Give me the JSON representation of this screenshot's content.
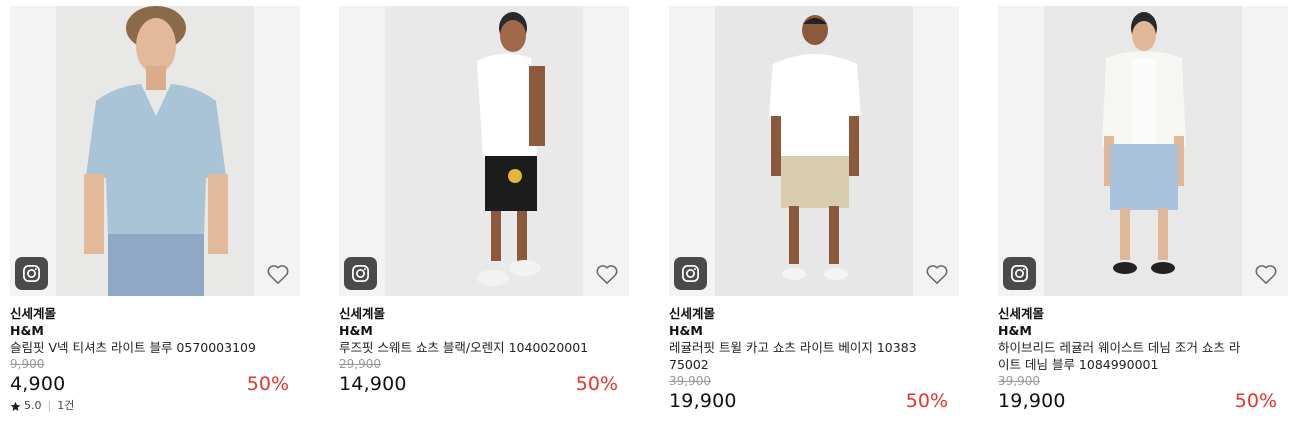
{
  "products": [
    {
      "shop": "신세계몰",
      "brand": "H&M",
      "name": "슬림핏 V넥 티셔츠 라이트 블루 0570003109",
      "original_price": "9,900",
      "price": "4,900",
      "discount": "50%",
      "rating_score": "5.0",
      "review_count": "1건",
      "icons": [
        "instagram-icon",
        "heart-icon",
        "star-icon"
      ]
    },
    {
      "shop": "신세계몰",
      "brand": "H&M",
      "name": "루즈핏 스웨트 쇼츠 블랙/오렌지 1040020001",
      "original_price": "29,900",
      "price": "14,900",
      "discount": "50%",
      "icons": [
        "instagram-icon",
        "heart-icon"
      ]
    },
    {
      "shop": "신세계몰",
      "brand": "H&M",
      "name": "레귤러핏 트윌 카고 쇼츠 라이트 베이지 1038375002",
      "original_price": "39,900",
      "price": "19,900",
      "discount": "50%",
      "icons": [
        "instagram-icon",
        "heart-icon"
      ]
    },
    {
      "shop": "신세계몰",
      "brand": "H&M",
      "name": "하이브리드 레귤러 웨이스트 데님 조거 쇼츠 라이트 데님 블루 1084990001",
      "original_price": "39,900",
      "price": "19,900",
      "discount": "50%",
      "icons": [
        "instagram-icon",
        "heart-icon"
      ]
    }
  ],
  "colors": {
    "discount": "#e4342b",
    "strikethrough": "#9a9a9a",
    "insta_button_bg": "#4a4a4a"
  }
}
